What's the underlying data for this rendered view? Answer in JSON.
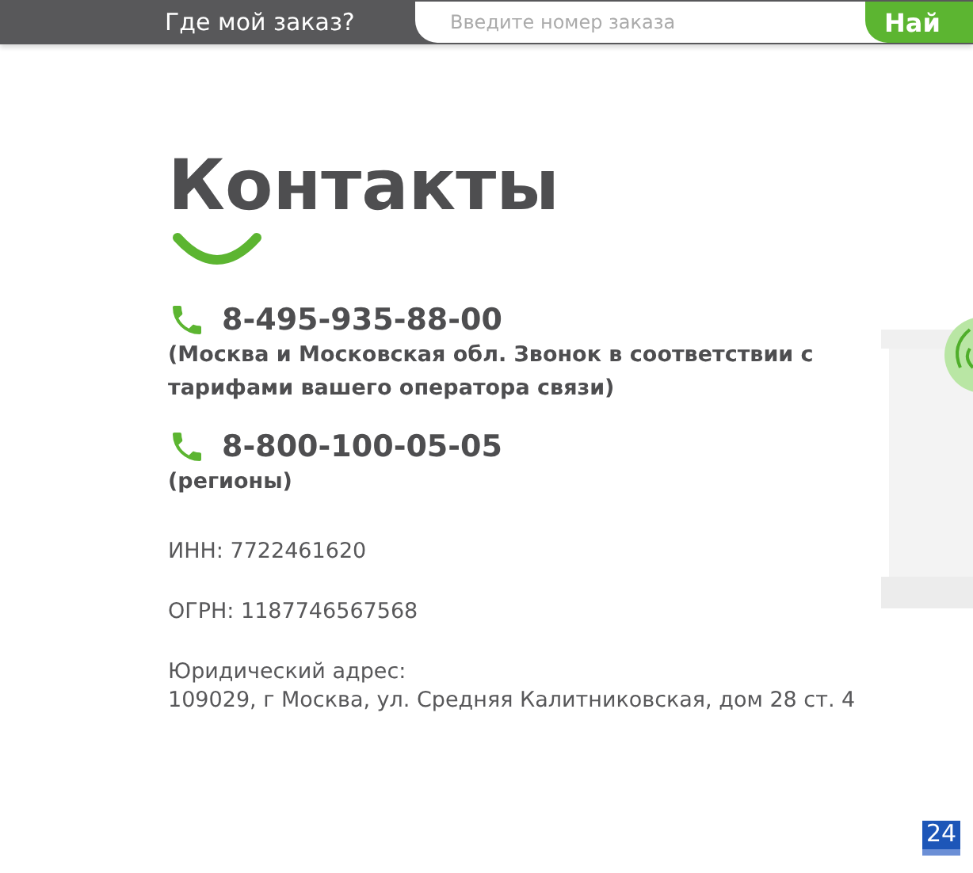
{
  "header": {
    "label": "Где мой заказ?",
    "search": {
      "placeholder": "Введите номер заказа"
    },
    "button": "Най"
  },
  "title": "Контакты",
  "phones": [
    {
      "number": "8-495-935-88-00",
      "note": "(Москва и Московская обл. Звонок в соответствии с тарифами вашего оператора связи)"
    },
    {
      "number": "8-800-100-05-05",
      "note": "(регионы)"
    }
  ],
  "details": [
    {
      "lines": [
        "ИНН: 7722461620"
      ]
    },
    {
      "lines": [
        "ОГРН: 1187746567568"
      ]
    },
    {
      "lines": [
        "Юридический адрес:",
        "109029, г Москва, ул. Средняя Калитниковская, дом 28 ст. 4"
      ]
    }
  ],
  "widget": "24"
}
